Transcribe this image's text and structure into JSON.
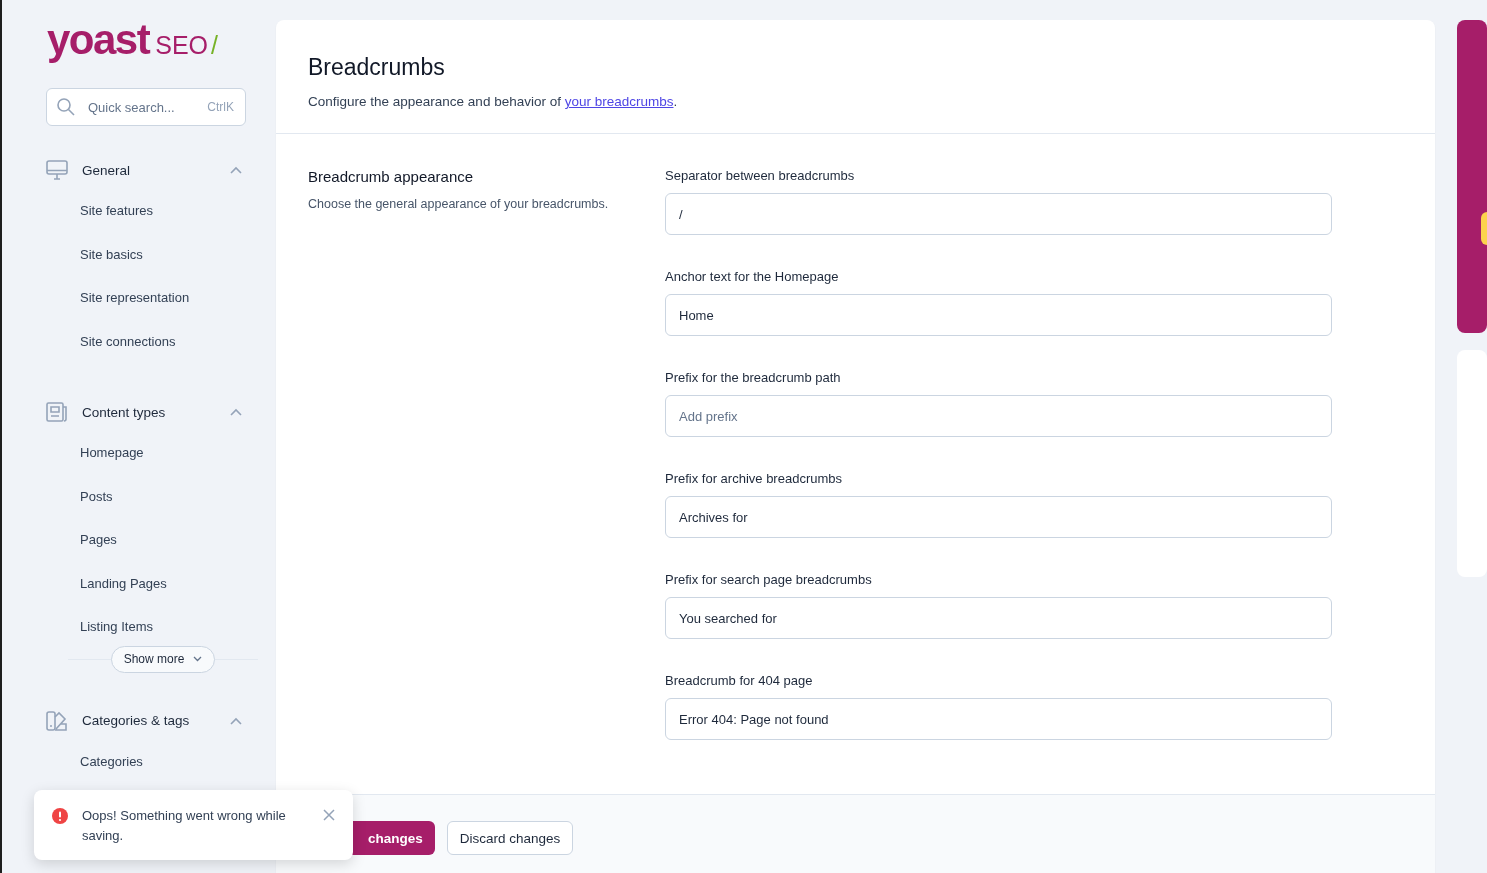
{
  "logo": {
    "wordmark": "yoast",
    "product": "SEO",
    "mark": "/"
  },
  "search": {
    "placeholder": "Quick search...",
    "shortcut": "CtrlK"
  },
  "sidebar": {
    "groups": [
      {
        "kind": "monitor",
        "title": "General",
        "expanded": true,
        "items": [
          "Site features",
          "Site basics",
          "Site representation",
          "Site connections"
        ]
      },
      {
        "kind": "document",
        "title": "Content types",
        "expanded": true,
        "items": [
          "Homepage",
          "Posts",
          "Pages",
          "Landing Pages",
          "Listing Items"
        ],
        "more": "Show more"
      },
      {
        "kind": "tag",
        "title": "Categories & tags",
        "expanded": true,
        "items": [
          "Categories"
        ]
      }
    ]
  },
  "page": {
    "title": "Breadcrumbs",
    "description": "Configure the appearance and behavior of ",
    "link": "your breadcrumbs",
    "after": "."
  },
  "section": {
    "title": "Breadcrumb appearance",
    "description": "Choose the general appearance of your breadcrumbs."
  },
  "fields": [
    {
      "label": "Separator between breadcrumbs",
      "value": "/"
    },
    {
      "label": "Anchor text for the Homepage",
      "value": "Home"
    },
    {
      "label": "Prefix for the breadcrumb path",
      "placeholder": "Add prefix"
    },
    {
      "label": "Prefix for archive breadcrumbs",
      "value": "Archives for"
    },
    {
      "label": "Prefix for search page breadcrumbs",
      "value": "You searched for"
    },
    {
      "label": "Breadcrumb for 404 page",
      "value": "Error 404: Page not found"
    }
  ],
  "footer": {
    "save": "changes",
    "discard": "Discard changes"
  },
  "toast": {
    "message": "Oops! Something went wrong while saving."
  }
}
